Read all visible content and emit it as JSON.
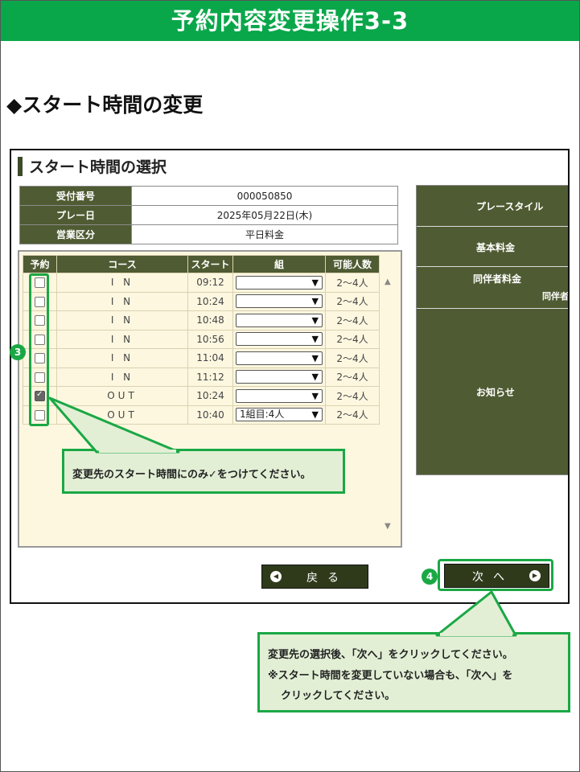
{
  "header": {
    "title": "予約内容変更操作3-3"
  },
  "section": {
    "heading": "◆スタート時間の変更"
  },
  "screen": {
    "title": "スタート時間の選択",
    "info": [
      {
        "label": "受付番号",
        "value": "000050850"
      },
      {
        "label": "プレー日",
        "value": "2025年05月22日(木)"
      },
      {
        "label": "営業区分",
        "value": "平日料金"
      }
    ],
    "right_panel": {
      "play_style": "プレースタイル",
      "base_fee": "基本料金",
      "companion_fee": "同伴者料金",
      "companion_sub": "同伴者",
      "notice": "お知らせ"
    },
    "table": {
      "headers": [
        "予約",
        "コース",
        "スタート",
        "組",
        "可能人数"
      ],
      "rows": [
        {
          "checked": false,
          "course": "I N",
          "start": "09:12",
          "group": "",
          "capacity": "2～4人"
        },
        {
          "checked": false,
          "course": "I N",
          "start": "10:24",
          "group": "",
          "capacity": "2～4人"
        },
        {
          "checked": false,
          "course": "I N",
          "start": "10:48",
          "group": "",
          "capacity": "2～4人"
        },
        {
          "checked": false,
          "course": "I N",
          "start": "10:56",
          "group": "",
          "capacity": "2～4人"
        },
        {
          "checked": false,
          "course": "I N",
          "start": "11:04",
          "group": "",
          "capacity": "2～4人"
        },
        {
          "checked": false,
          "course": "I N",
          "start": "11:12",
          "group": "",
          "capacity": "2～4人"
        },
        {
          "checked": true,
          "course": "OUT",
          "start": "10:24",
          "group": "",
          "capacity": "2～4人"
        },
        {
          "checked": false,
          "course": "OUT",
          "start": "10:40",
          "group": "1組目:4人",
          "capacity": "2～4人"
        }
      ]
    },
    "buttons": {
      "back": "戻る",
      "next": "次へ"
    }
  },
  "badges": {
    "step3": "3",
    "step4": "4"
  },
  "callouts": {
    "checkbox_note": "変更先のスタート時間にのみ✓をつけてください。",
    "next_note_1": "変更先の選択後、「次へ」をクリックしてください。",
    "next_note_2": "※スタート時間を変更していない場合も、「次へ」を",
    "next_note_3": "クリックしてください。"
  },
  "colors": {
    "accent_green": "#0aa74a",
    "panel_olive": "#4f5b32",
    "callout_bg": "#e2efd5"
  }
}
